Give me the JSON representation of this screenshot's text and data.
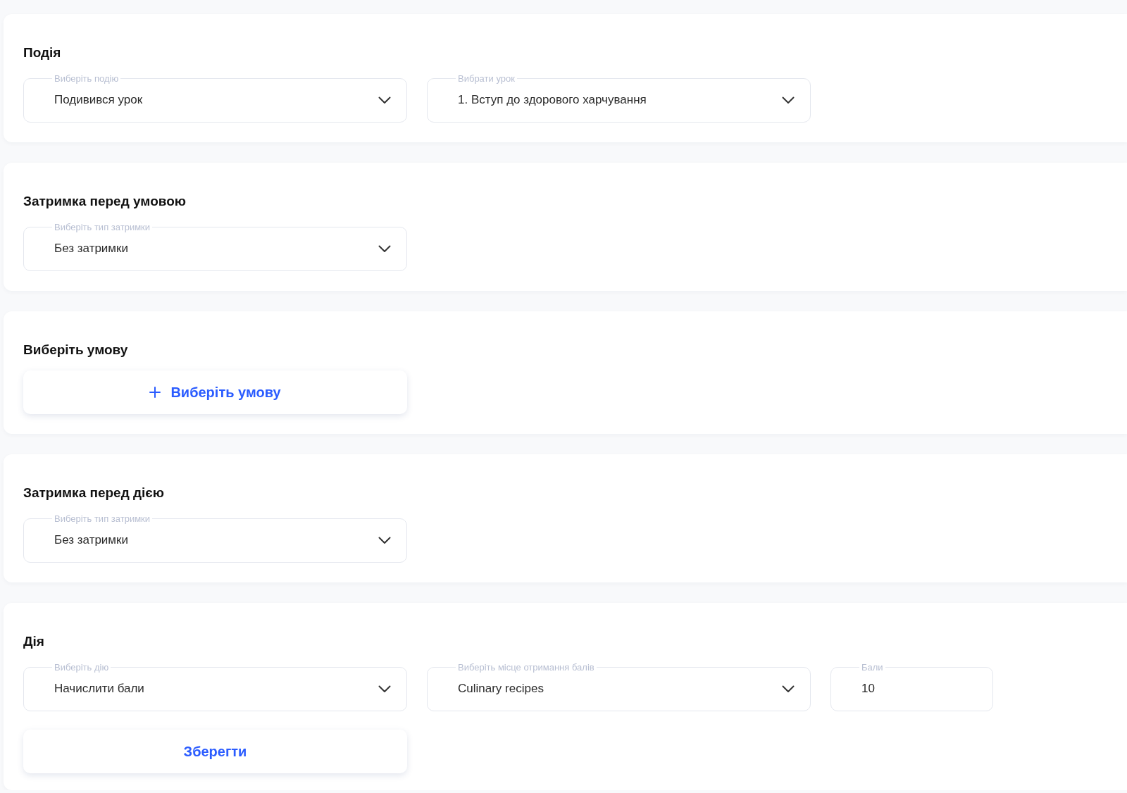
{
  "sections": [
    {
      "title": "Подія",
      "controls": [
        {
          "kind": "select",
          "label": "Виберіть подію",
          "value": "Подивився урок"
        },
        {
          "kind": "select",
          "label": "Вибрати урок",
          "value": "1. Вступ до здорового харчування"
        }
      ]
    },
    {
      "title": "Затримка перед умовою",
      "controls": [
        {
          "kind": "select",
          "label": "Виберіть тип затримки",
          "value": "Без затримки"
        }
      ]
    },
    {
      "title": "Виберіть умову",
      "controls": [
        {
          "kind": "add",
          "label": "Виберіть умову"
        }
      ]
    },
    {
      "title": "Затримка перед дією",
      "controls": [
        {
          "kind": "select",
          "label": "Виберіть тип затримки",
          "value": "Без затримки"
        }
      ]
    },
    {
      "title": "Дія",
      "controls": [
        {
          "kind": "select",
          "label": "Виберіть дію",
          "value": "Начислити бали"
        },
        {
          "kind": "select",
          "label": "Виберіть місце отримання балів",
          "value": "Culinary recipes"
        },
        {
          "kind": "number",
          "label": "Бали",
          "value": "10"
        },
        {
          "kind": "save",
          "label": "Зберегти"
        }
      ]
    }
  ]
}
